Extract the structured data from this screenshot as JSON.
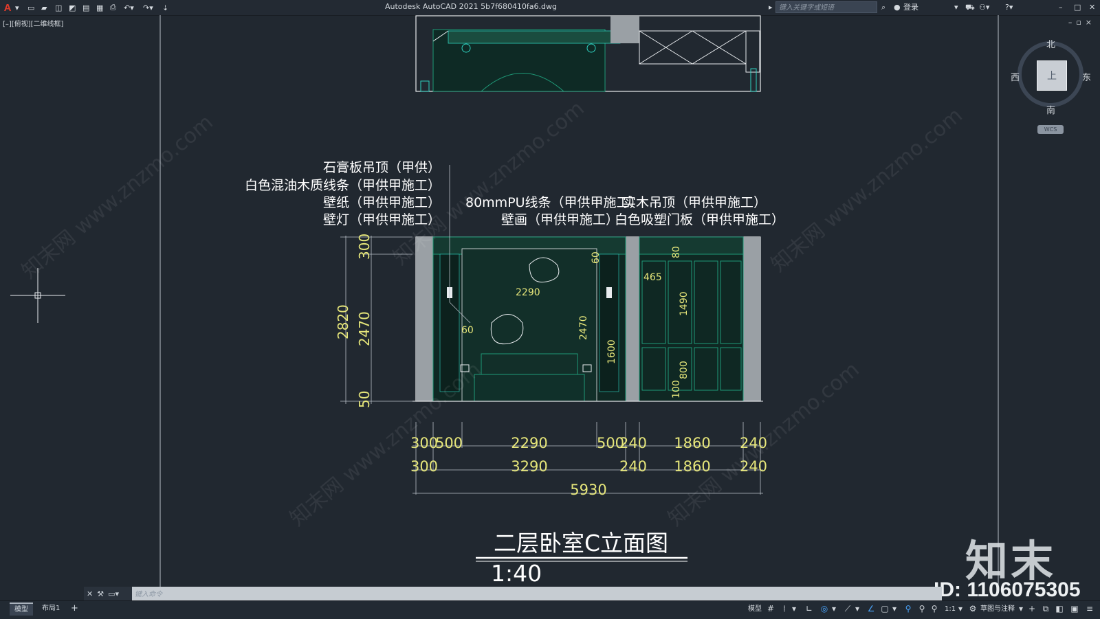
{
  "title_bar": {
    "app_title": "Autodesk AutoCAD 2021    5b7f680410fa6.dwg",
    "search_placeholder": "键入关键字或短语",
    "login_label": "登录"
  },
  "viewport": {
    "label": "[–][俯视][二维线框]",
    "controls": "–▫×"
  },
  "viewcube": {
    "north": "北",
    "south": "南",
    "west": "西",
    "east": "东",
    "face": "上",
    "wcs": "WCS"
  },
  "drawing": {
    "callouts_left": [
      "石膏板吊顶（甲供）",
      "白色混油木质线条（甲供甲施工）",
      "壁纸（甲供甲施工）",
      "壁灯（甲供甲施工）"
    ],
    "callouts_right": [
      "80mmPU线条（甲供甲施工）",
      "实木吊顶（甲供甲施工）",
      "壁画（甲供甲施工）",
      "白色吸塑门板（甲供甲施工）"
    ],
    "dims_left": [
      "300",
      "2820",
      "2470",
      "50"
    ],
    "dims_inner": [
      "60",
      "2290",
      "60",
      "2470",
      "1600",
      "465",
      "80",
      "1490",
      "800",
      "100"
    ],
    "dims_row1": [
      "300",
      "500",
      "2290",
      "500",
      "240",
      "1860",
      "240"
    ],
    "dims_row2": [
      "300",
      "3290",
      "240",
      "1860",
      "240"
    ],
    "dims_total": "5930",
    "drawing_title": "二层卧室C立面图",
    "scale": "1:40"
  },
  "command_line": {
    "placeholder": "键入命令"
  },
  "status_bar": {
    "tabs": [
      "模型",
      "布局1"
    ],
    "add_tab": "+",
    "model_label": "模型",
    "scale_label": "1:1",
    "workspace_label": "草图与注释"
  },
  "watermark": {
    "brand": "知末",
    "id": "ID: 1106075305",
    "site": "知末网 www.znzmo.com"
  },
  "colors": {
    "background": "#212830",
    "dim_text": "#e6e67a",
    "drawing_green": "#1f9a78",
    "drawing_teal": "#2fd2c0",
    "callout_text": "#ffffff"
  }
}
